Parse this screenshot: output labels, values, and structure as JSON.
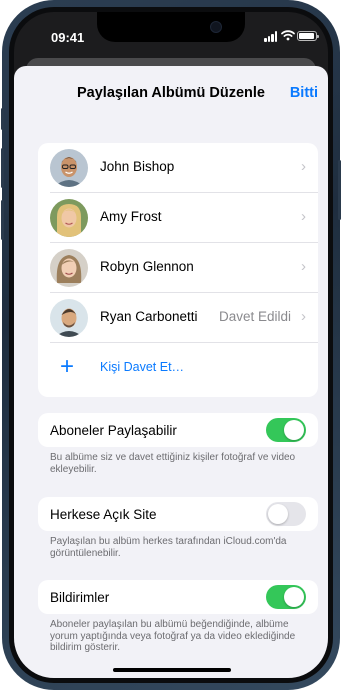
{
  "status_bar": {
    "time": "09:41"
  },
  "nav": {
    "title": "Paylaşılan Albümü Düzenle",
    "done": "Bitti"
  },
  "people": [
    {
      "name": "John Bishop",
      "status": ""
    },
    {
      "name": "Amy Frost",
      "status": ""
    },
    {
      "name": "Robyn Glennon",
      "status": ""
    },
    {
      "name": "Ryan Carbonetti",
      "status": "Davet Edildi"
    }
  ],
  "invite": {
    "label": "Kişi Davet Et…"
  },
  "settings": [
    {
      "label": "Aboneler Paylaşabilir",
      "on": true,
      "footer": "Bu albüme siz ve davet ettiğiniz kişiler fotoğraf ve video ekleyebilir."
    },
    {
      "label": "Herkese Açık Site",
      "on": false,
      "footer": "Paylaşılan bu albüm herkes tarafından iCloud.com'da görüntülenebilir."
    },
    {
      "label": "Bildirimler",
      "on": true,
      "footer": "Aboneler paylaşılan bu albümü beğendiğinde, albüme yorum yaptığında veya fotoğraf ya da video eklediğinde bildirim gösterir."
    }
  ],
  "colors": {
    "accent": "#0a7aff",
    "toggle_on": "#34c759",
    "toggle_off": "#e5e5ea",
    "frame": "#2c3e52"
  },
  "icons": [
    "signal-icon",
    "wifi-icon",
    "battery-icon",
    "chevron-right-icon",
    "plus-icon"
  ]
}
